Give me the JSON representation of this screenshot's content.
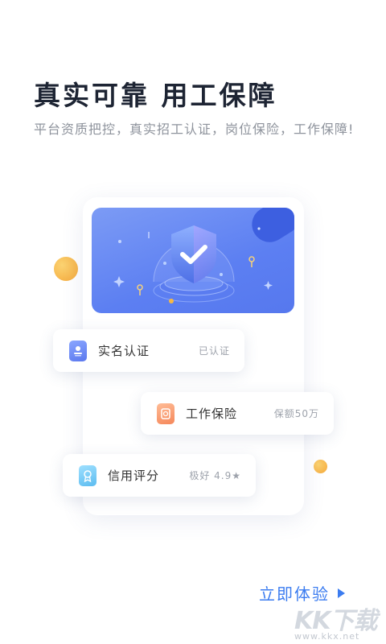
{
  "hero": {
    "title": "真实可靠 用工保障",
    "subtitle": "平台资质把控，真实招工认证，岗位保险，工作保障!"
  },
  "cards": [
    {
      "label": "实名认证",
      "value": "已认证",
      "icon": "id-card-icon",
      "color": "#5b78ee"
    },
    {
      "label": "工作保险",
      "value": "保额50万",
      "icon": "insurance-doc-icon",
      "color": "#f59a6c"
    },
    {
      "label": "信用评分",
      "value": "极好 4.9★",
      "icon": "credit-badge-icon",
      "color": "#6fc8f2"
    }
  ],
  "banner": {
    "icon": "shield-check-icon"
  },
  "cta": {
    "label": "立即体验"
  },
  "watermark": {
    "brand": "KK下载",
    "url": "www.kkx.net"
  },
  "colors": {
    "accent": "#3b7cf0",
    "banner": "#5c7ff2",
    "dot": "#f7b843"
  }
}
